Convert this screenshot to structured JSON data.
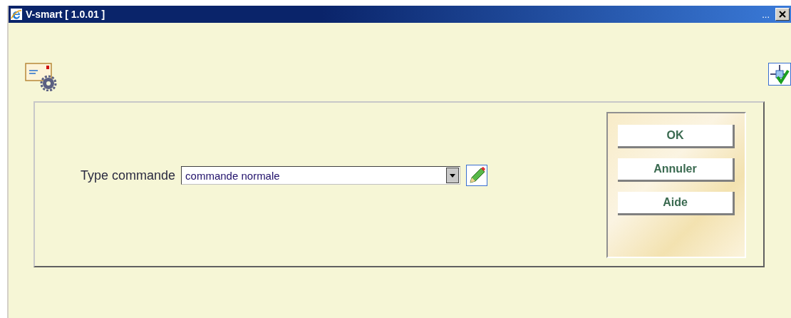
{
  "window": {
    "title": "V-smart [ 1.0.01 ]",
    "title_extra": "..."
  },
  "form": {
    "label": "Type commande",
    "select": {
      "value": "commande normale"
    }
  },
  "buttons": [
    {
      "label": "OK"
    },
    {
      "label": "Annuler"
    },
    {
      "label": "Aide"
    }
  ]
}
